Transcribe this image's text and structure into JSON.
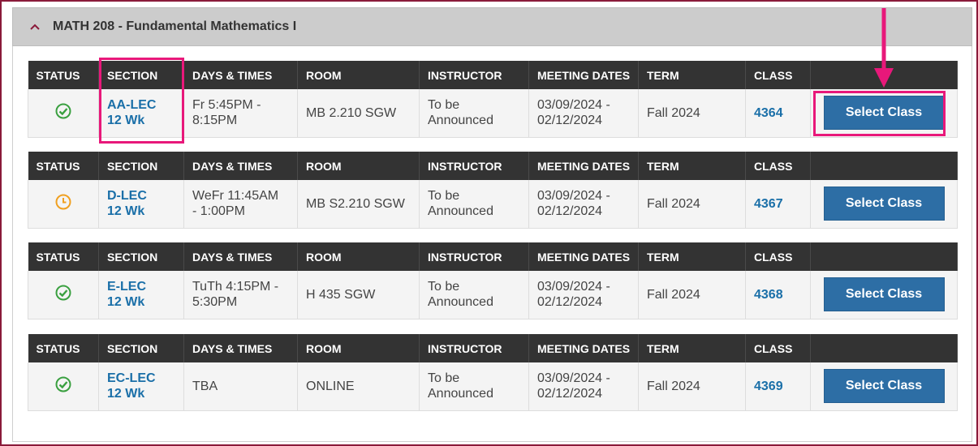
{
  "panel": {
    "title": "MATH 208 - Fundamental Mathematics I",
    "collapse_icon": "chevron-up-icon"
  },
  "table_headers": [
    "STATUS",
    "SECTION",
    "DAYS & TIMES",
    "ROOM",
    "INSTRUCTOR",
    "MEETING DATES",
    "TERM",
    "CLASS",
    ""
  ],
  "sections": [
    {
      "status": "open",
      "status_icon": "check-circle-icon",
      "section_line1": "AA-LEC",
      "section_line2": "12 Wk",
      "days_times_line1": "Fr 5:45PM -",
      "days_times_line2": "8:15PM",
      "room": "MB 2.210 SGW",
      "instructor_line1": "To be",
      "instructor_line2": "Announced",
      "meeting_dates_line1": "03/09/2024 -",
      "meeting_dates_line2": "02/12/2024",
      "term": "Fall 2024",
      "class_number": "4364",
      "button_label": "Select Class"
    },
    {
      "status": "waitlist",
      "status_icon": "clock-icon",
      "section_line1": "D-LEC",
      "section_line2": "12 Wk",
      "days_times_line1": "WeFr 11:45AM",
      "days_times_line2": "- 1:00PM",
      "room": "MB S2.210 SGW",
      "instructor_line1": "To be",
      "instructor_line2": "Announced",
      "meeting_dates_line1": "03/09/2024 -",
      "meeting_dates_line2": "02/12/2024",
      "term": "Fall 2024",
      "class_number": "4367",
      "button_label": "Select Class"
    },
    {
      "status": "open",
      "status_icon": "check-circle-icon",
      "section_line1": "E-LEC",
      "section_line2": "12 Wk",
      "days_times_line1": "TuTh 4:15PM -",
      "days_times_line2": "5:30PM",
      "room": "H 435 SGW",
      "instructor_line1": "To be",
      "instructor_line2": "Announced",
      "meeting_dates_line1": "03/09/2024 -",
      "meeting_dates_line2": "02/12/2024",
      "term": "Fall 2024",
      "class_number": "4368",
      "button_label": "Select Class"
    },
    {
      "status": "open",
      "status_icon": "check-circle-icon",
      "section_line1": "EC-LEC",
      "section_line2": "12 Wk",
      "days_times_line1": "TBA",
      "days_times_line2": "",
      "room": "ONLINE",
      "instructor_line1": "To be",
      "instructor_line2": "Announced",
      "meeting_dates_line1": "03/09/2024 -",
      "meeting_dates_line2": "02/12/2024",
      "term": "Fall 2024",
      "class_number": "4369",
      "button_label": "Select Class"
    }
  ],
  "colors": {
    "frame_border": "#8a1a3a",
    "header_bar": "#333333",
    "link": "#1a6fa8",
    "button": "#2d6ea5",
    "open_status": "#3aa040",
    "waitlist_status": "#f0a020",
    "highlight": "#e8187a"
  }
}
